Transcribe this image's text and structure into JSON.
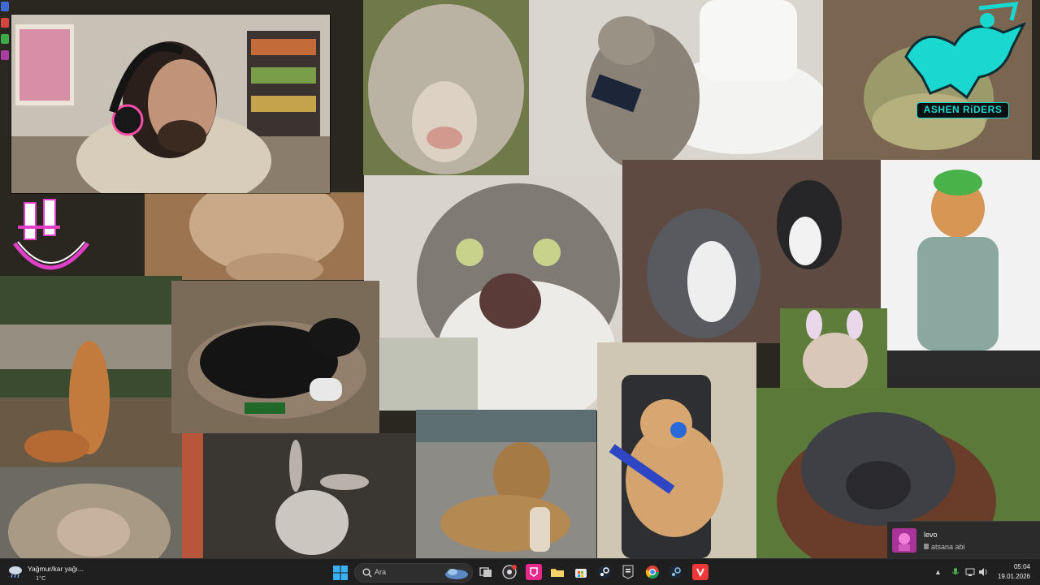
{
  "desktop": {
    "tiles": [
      {
        "name": "sheep-photo",
        "subject": "shaggy sheep"
      },
      {
        "name": "cat-toilet-phone-photo",
        "subject": "cat on toilet with phone"
      },
      {
        "name": "ashen-riders-frog-photo",
        "subject": "frog"
      },
      {
        "name": "beige-cat-photo",
        "subject": "beige cat"
      },
      {
        "name": "shocked-cat-photo",
        "subject": "shocked cat"
      },
      {
        "name": "fighting-dogs-photo",
        "subject": "pit bull and cat"
      },
      {
        "name": "cat-green-hat-photo",
        "subject": "cat in green hat"
      },
      {
        "name": "bunny-ears-dog-photo",
        "subject": "bulldog with bunny ears"
      },
      {
        "name": "squirrel-photo",
        "subject": "squirrel arms up"
      },
      {
        "name": "black-dog-controller-photo",
        "subject": "black dog with controller"
      },
      {
        "name": "gamer-cat-photo",
        "subject": "cat with headset and keyboard"
      },
      {
        "name": "orangutan-photo",
        "subject": "orangutan"
      },
      {
        "name": "monkey-photo",
        "subject": "monkey"
      },
      {
        "name": "donkey-photo",
        "subject": "donkey"
      },
      {
        "name": "dog-bread-photo",
        "subject": "dog with bread"
      }
    ],
    "overlay_logo": "ASHEN RiDERS"
  },
  "webcam": {
    "subject": "streamer with headset"
  },
  "notification": {
    "name": "levo",
    "message": "atsana abi"
  },
  "taskbar": {
    "weather": {
      "title": "Yağmur/kar yağı...",
      "temp": "1°C"
    },
    "search_placeholder": "Ara",
    "apps": [
      {
        "name": "task-view-icon",
        "color": "#9e9e9e"
      },
      {
        "name": "obs-icon",
        "color": "#3a3a3a"
      },
      {
        "name": "twitch-pink-app-icon",
        "color": "#e8288a"
      },
      {
        "name": "file-explorer-icon",
        "color": "#f2c14e"
      },
      {
        "name": "store-icon",
        "color": "#e9e9e9"
      },
      {
        "name": "steam-icon",
        "color": "#1b2838"
      },
      {
        "name": "epic-games-icon",
        "color": "#2a2a2a"
      },
      {
        "name": "chrome-icon",
        "color": "#4285f4"
      },
      {
        "name": "steam-2-icon",
        "color": "#1b2838"
      },
      {
        "name": "vivaldi-icon",
        "color": "#ef3939"
      }
    ],
    "clock": {
      "time": "05:04",
      "date": "19.01.2026"
    }
  },
  "colors": {
    "taskbar": "#1f1f1f",
    "accent": "#19d8d0",
    "logo_pink": "#e040c8"
  }
}
